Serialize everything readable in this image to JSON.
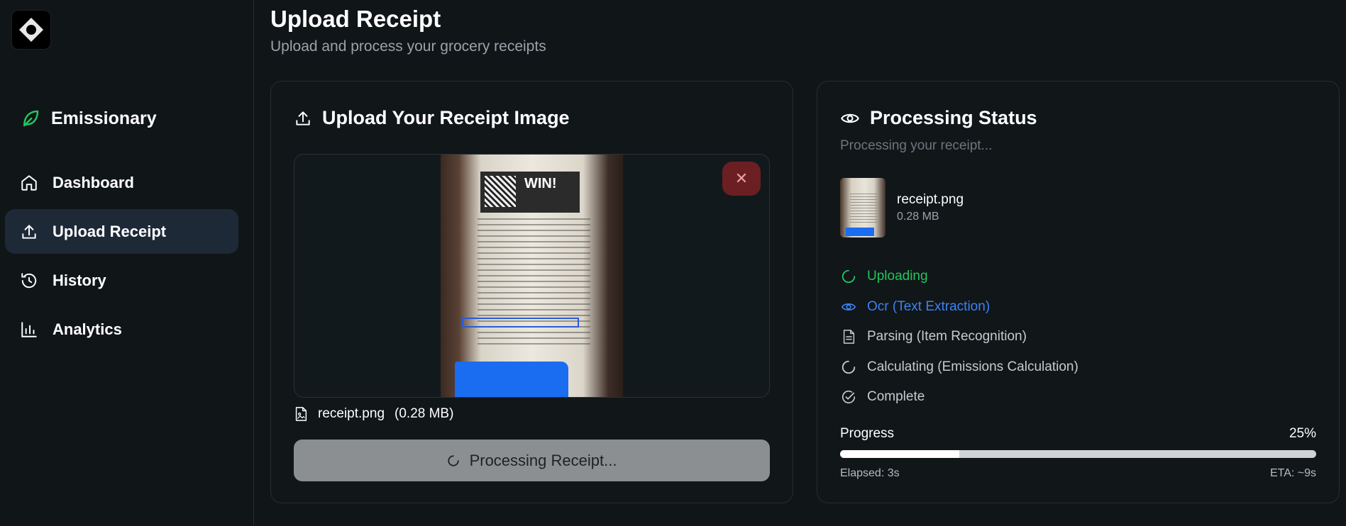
{
  "sidebar": {
    "brand": "Emissionary",
    "items": [
      {
        "label": "Dashboard",
        "icon": "home-icon",
        "active": false
      },
      {
        "label": "Upload Receipt",
        "icon": "upload-icon",
        "active": true
      },
      {
        "label": "History",
        "icon": "history-icon",
        "active": false
      },
      {
        "label": "Analytics",
        "icon": "bar-chart-icon",
        "active": false
      }
    ]
  },
  "header": {
    "title": "Upload Receipt",
    "subtitle": "Upload and process your grocery receipts"
  },
  "upload": {
    "title": "Upload Your Receipt Image",
    "file_name": "receipt.png",
    "file_size": "(0.28 MB)",
    "button_label": "Processing Receipt..."
  },
  "status": {
    "title": "Processing Status",
    "subtitle": "Processing your receipt...",
    "file_name": "receipt.png",
    "file_size": "0.28 MB",
    "steps": [
      {
        "label": "Uploading",
        "state": "done",
        "color": "#22c55e"
      },
      {
        "label": "Ocr (Text Extraction)",
        "state": "active",
        "color": "#3b82f6"
      },
      {
        "label": "Parsing (Item Recognition)",
        "state": "pending",
        "color": "#c6cbcf"
      },
      {
        "label": "Calculating (Emissions Calculation)",
        "state": "pending",
        "color": "#c6cbcf"
      },
      {
        "label": "Complete",
        "state": "pending",
        "color": "#c6cbcf"
      }
    ],
    "progress_label": "Progress",
    "progress_text": "25%",
    "progress_value": 0.25,
    "elapsed": "Elapsed: 3s",
    "eta": "ETA: ~9s"
  },
  "colors": {
    "accent_green": "#22c55e",
    "accent_blue": "#3b82f6",
    "danger": "#6b1f22"
  }
}
